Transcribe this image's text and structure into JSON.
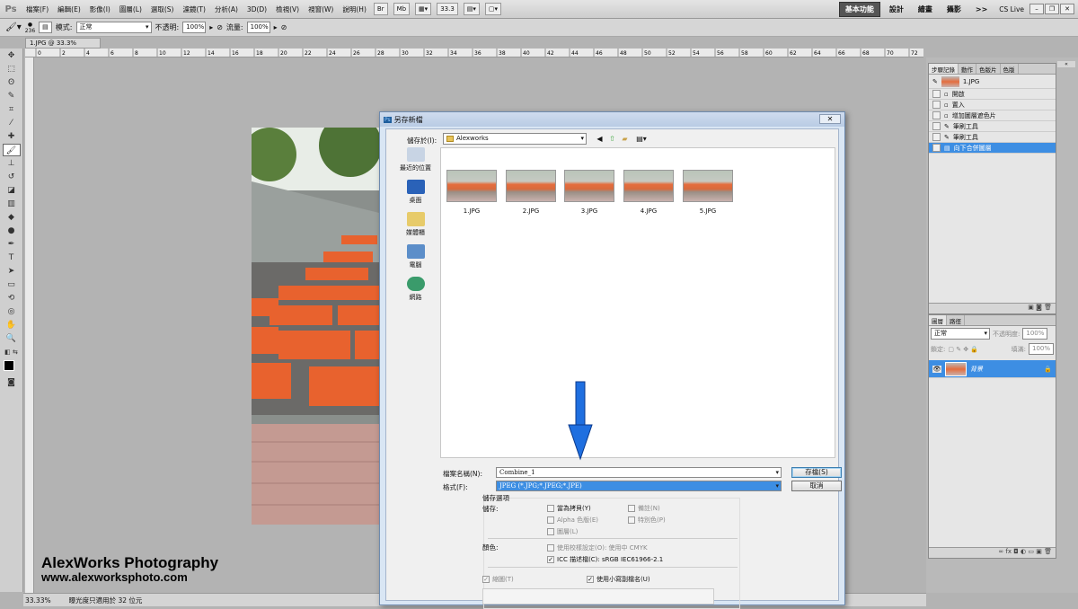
{
  "app": {
    "logo": "Ps"
  },
  "menu": [
    "檔案(F)",
    "編輯(E)",
    "影像(I)",
    "圖層(L)",
    "選取(S)",
    "濾鏡(T)",
    "分析(A)",
    "3D(D)",
    "檢視(V)",
    "視窗(W)",
    "說明(H)"
  ],
  "zoom_field": "33.3",
  "workspaces": [
    "基本功能",
    "設計",
    "繪畫",
    "攝影",
    ">>"
  ],
  "cslive": "CS Live",
  "options": {
    "brush_size": "236",
    "mode_label": "模式:",
    "mode_value": "正常",
    "opacity_label": "不透明:",
    "opacity_value": "100%",
    "flow_label": "流量:",
    "flow_value": "100%"
  },
  "document_tab": "1.JPG @ 33.3% (RGB/8)",
  "ruler_marks": [
    "0",
    "2",
    "4",
    "6",
    "8",
    "10",
    "12",
    "14",
    "16",
    "18",
    "20",
    "22",
    "24",
    "26",
    "28",
    "30",
    "32",
    "34",
    "36",
    "38",
    "40",
    "42",
    "44",
    "46",
    "48",
    "50",
    "52",
    "54",
    "56",
    "58",
    "60",
    "62",
    "64",
    "66",
    "68",
    "70",
    "72"
  ],
  "status": {
    "zoom": "33.33%",
    "info": "曝光度只適用於 32 位元"
  },
  "watermark": {
    "line1": "AlexWorks Photography",
    "line2": "www.alexworksphoto.com"
  },
  "history_panel": {
    "tabs": [
      "步驟記錄",
      "動作",
      "色版片",
      "色版"
    ],
    "snapshot": "1.JPG",
    "items": [
      "開啟",
      "置入",
      "增加圖層遮色片",
      "筆刷工具",
      "筆刷工具",
      "向下合併圖層"
    ]
  },
  "layers_panel": {
    "tabs": [
      "圖層",
      "路徑"
    ],
    "blend": "正常",
    "opacity_label": "不透明度:",
    "opacity_value": "100%",
    "lock_label": "鎖定:",
    "fill_label": "填滿:",
    "fill_value": "100%",
    "layer_name": "背景"
  },
  "dialog": {
    "title": "另存新檔",
    "save_in_label": "儲存於(I):",
    "save_in_value": "Alexworks",
    "places": [
      "最近的位置",
      "桌面",
      "媒體櫃",
      "電腦",
      "網路"
    ],
    "files": [
      "1.JPG",
      "2.JPG",
      "3.JPG",
      "4.JPG",
      "5.JPG"
    ],
    "filename_label": "檔案名稱(N):",
    "filename_value": "Combine_1",
    "format_label": "格式(F):",
    "format_value": "JPEG (*.JPG;*.JPEG;*.JPE)",
    "save_button": "存檔(S)",
    "cancel_button": "取消",
    "options_heading": "儲存選項",
    "save_label": "儲存:",
    "as_copy": "當為拷貝(Y)",
    "notes": "備註(N)",
    "alpha": "Alpha 色版(E)",
    "spot": "特別色(P)",
    "layers": "圖層(L)",
    "color_label": "顏色:",
    "proof": "使用校樣設定(O): 使用中 CMYK",
    "icc": "ICC 描述檔(C): sRGB IEC61966-2.1",
    "thumbnail": "縮圖(T)",
    "lowercase": "使用小寫副檔名(U)"
  },
  "colors": {
    "accent": "#3d8ee3",
    "arrow": "#1f6fe0"
  }
}
